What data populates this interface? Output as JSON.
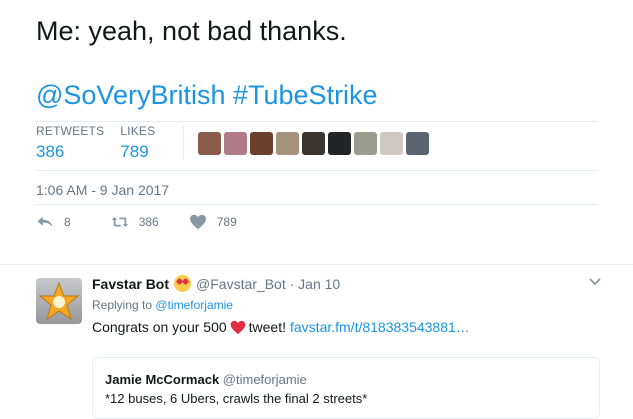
{
  "tweet": {
    "text": "Me: yeah, not bad thanks.",
    "mention": "@SoVeryBritish",
    "hashtag": "#TubeStrike",
    "retweets_label": "RETWEETS",
    "retweets_value": "386",
    "likes_label": "LIKES",
    "likes_value": "789",
    "timestamp": "1:06 AM - 9 Jan 2017",
    "reply_count": "8",
    "retweet_count": "386",
    "like_count": "789",
    "liker_avatars": [
      "#8a5a4a",
      "#b07a88",
      "#6b3f2c",
      "#a4927c",
      "#3b3531",
      "#222426",
      "#9a9c8e",
      "#cfc7c2",
      "#5a6470"
    ]
  },
  "reply": {
    "name": "Favstar Bot",
    "handle_date": "@Favstar_Bot · Jan 10",
    "replying_prefix": "Replying to",
    "replying_handle": "@timeforjamie",
    "body_prefix": "Congrats on your 500",
    "body_suffix": " tweet!",
    "link": "favstar.fm/t/818383543881…",
    "quote_name": "Jamie McCormack",
    "quote_handle": "@timeforjamie",
    "quote_text": "*12 buses, 6 Ubers, crawls the final 2 streets*"
  }
}
